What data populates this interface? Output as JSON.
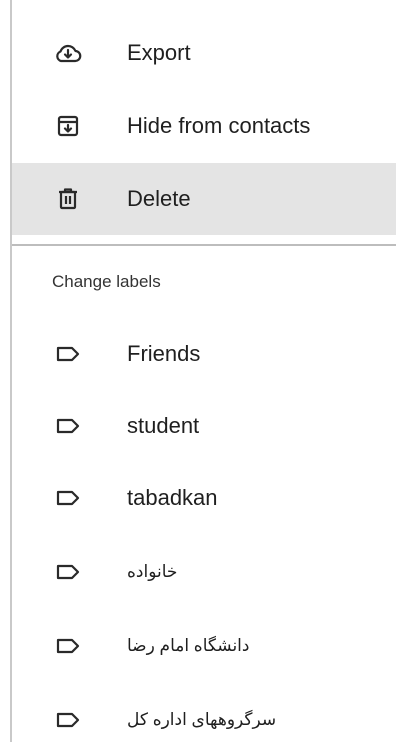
{
  "menu": {
    "actions": [
      {
        "label": "Export",
        "icon": "cloud-download-icon"
      },
      {
        "label": "Hide from contacts",
        "icon": "archive-icon"
      },
      {
        "label": "Delete",
        "icon": "trash-icon",
        "highlighted": true
      }
    ],
    "section_header": "Change labels",
    "labels": [
      {
        "label": "Friends",
        "icon": "label-icon"
      },
      {
        "label": "student",
        "icon": "label-icon"
      },
      {
        "label": "tabadkan",
        "icon": "label-icon"
      },
      {
        "label": "خانواده",
        "icon": "label-icon"
      },
      {
        "label": "دانشگاه امام رضا",
        "icon": "label-icon"
      },
      {
        "label": "سرگروههای اداره کل",
        "icon": "label-icon"
      }
    ]
  },
  "colors": {
    "highlight_bg": "#e4e4e4",
    "text": "#1f1f1f",
    "divider": "#bdbdbd"
  }
}
